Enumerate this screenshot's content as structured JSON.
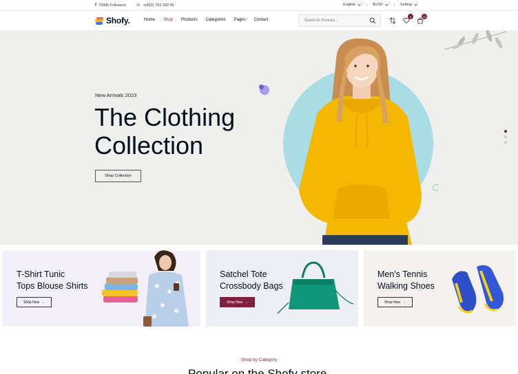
{
  "topbar": {
    "followers": "7500k Followers",
    "phone": "+(402) 763 282 46",
    "language": "English",
    "currency": "$USD",
    "setting": "Setting"
  },
  "header": {
    "logo": "Shofy.",
    "nav": [
      "Home",
      "Shop",
      "Products",
      "Categories",
      "Pages",
      "Contact"
    ],
    "active_nav": "Shop",
    "search_placeholder": "Search for Products...",
    "wishlist_count": "4",
    "cart_count": "13"
  },
  "hero": {
    "subtitle": "New Arrivals 2023",
    "title_line1": "The Clothing",
    "title_line2": "Collection",
    "cta": "Shop Collection"
  },
  "banners": [
    {
      "line1": "T-Shirt Tunic",
      "line2": "Tops Blouse Shirts",
      "cta": "Shop Now"
    },
    {
      "line1": "Satchel Tote",
      "line2": "Crossbody Bags",
      "cta": "Shop Now"
    },
    {
      "line1": "Men's Tennis",
      "line2": "Walking Shoes",
      "cta": "Shop Now"
    }
  ],
  "section": {
    "eyebrow": "Shop by Category",
    "heading": "Popular on the Shofy store."
  },
  "colors": {
    "accent": "#821f40",
    "hero_bg": "#eff0ed",
    "hoodie": "#f5b800",
    "circle": "#a8dde6"
  }
}
